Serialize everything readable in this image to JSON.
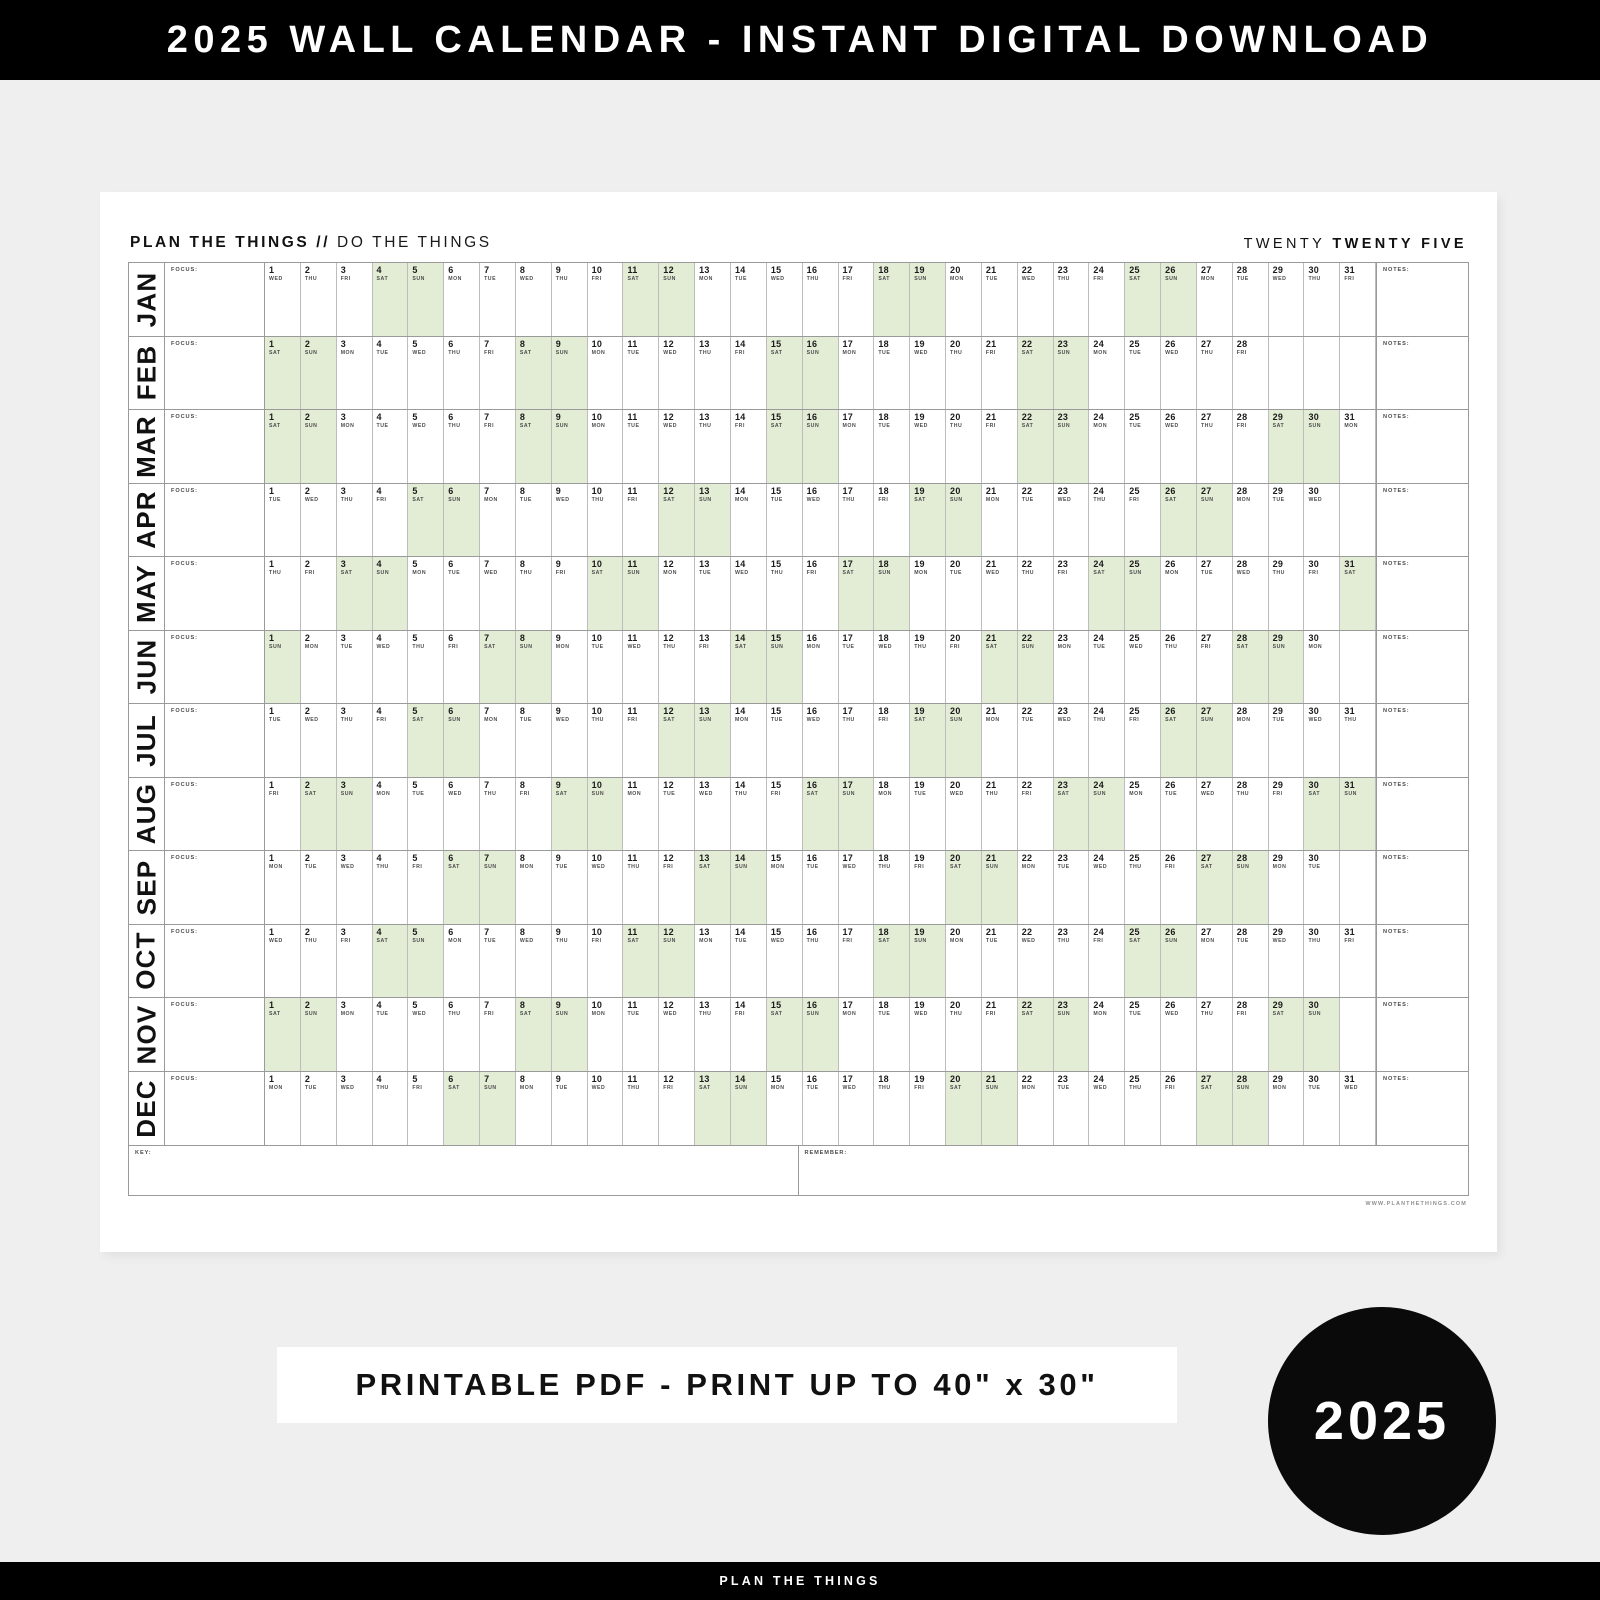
{
  "top_banner": {
    "title": "2025 WALL CALENDAR - INSTANT DIGITAL DOWNLOAD"
  },
  "card": {
    "brand_bold": "PLAN THE THINGS",
    "brand_slash": "//",
    "brand_light": "DO THE THINGS",
    "year_light": "TWENTY",
    "year_bold": "TWENTY FIVE",
    "focus_label": "FOCUS:",
    "notes_label": "NOTES:",
    "key_label": "KEY:",
    "remember_label": "REMEMBER:",
    "website": "WWW.PLANTHETHINGS.COM"
  },
  "colors": {
    "weekend_highlight": "#e3ecd5",
    "banner_black": "#000000",
    "page_background": "#efefef",
    "card_white": "#ffffff",
    "grid_line": "#9a9a9a"
  },
  "calendar": {
    "year": "2025",
    "weekday_abbrev": [
      "MON",
      "TUE",
      "WED",
      "THU",
      "FRI",
      "SAT",
      "SUN"
    ],
    "months": [
      {
        "label": "JAN",
        "days": 31,
        "first_weekday": 2
      },
      {
        "label": "FEB",
        "days": 28,
        "first_weekday": 5
      },
      {
        "label": "MAR",
        "days": 31,
        "first_weekday": 5
      },
      {
        "label": "APR",
        "days": 30,
        "first_weekday": 1
      },
      {
        "label": "MAY",
        "days": 31,
        "first_weekday": 3
      },
      {
        "label": "JUN",
        "days": 30,
        "first_weekday": 6
      },
      {
        "label": "JUL",
        "days": 31,
        "first_weekday": 1
      },
      {
        "label": "AUG",
        "days": 31,
        "first_weekday": 4
      },
      {
        "label": "SEP",
        "days": 30,
        "first_weekday": 0
      },
      {
        "label": "OCT",
        "days": 31,
        "first_weekday": 2
      },
      {
        "label": "NOV",
        "days": 30,
        "first_weekday": 5
      },
      {
        "label": "DEC",
        "days": 31,
        "first_weekday": 0
      }
    ]
  },
  "promo": {
    "pdf_text": "PRINTABLE PDF - PRINT UP TO 40\" x 30\"",
    "year_badge": "2025"
  },
  "bottom_banner": {
    "text": "PLAN THE THINGS"
  }
}
